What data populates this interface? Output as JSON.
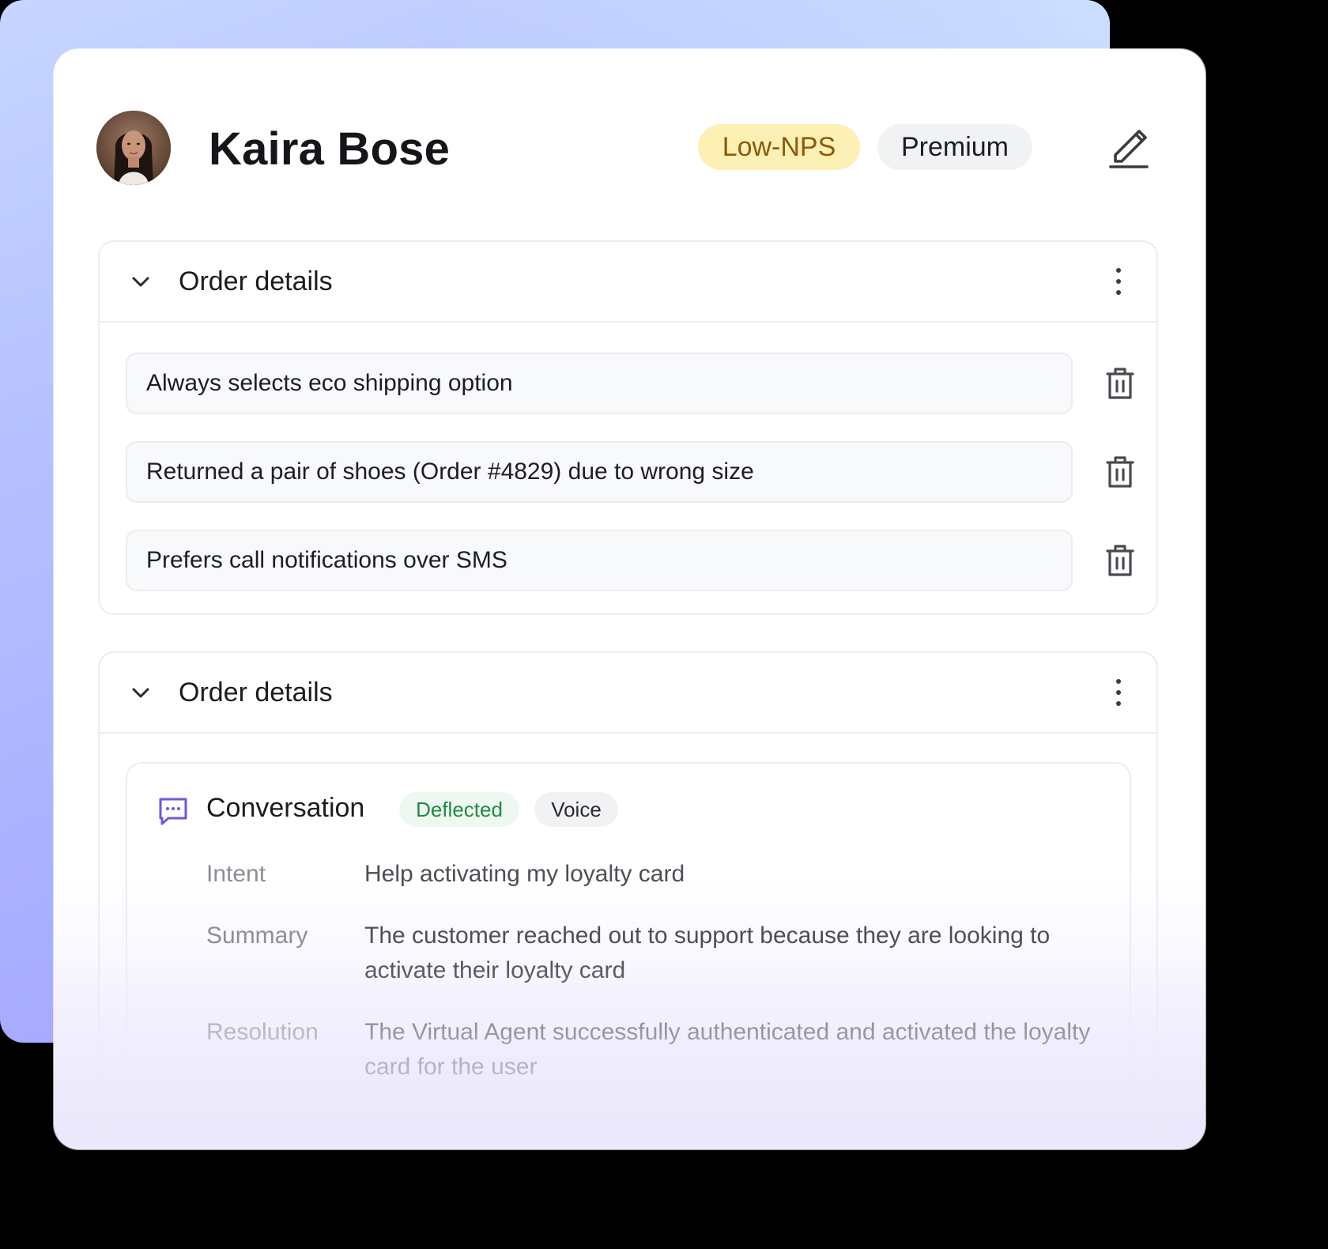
{
  "profile": {
    "name": "Kaira Bose",
    "badges": [
      "Low-NPS",
      "Premium"
    ]
  },
  "sections": [
    {
      "title": "Order details",
      "items": [
        "Always selects eco shipping option",
        "Returned a pair of shoes (Order #4829) due to wrong size",
        "Prefers call notifications over SMS"
      ]
    },
    {
      "title": "Order details",
      "conversation": {
        "title": "Conversation",
        "tags": [
          "Deflected",
          "Voice"
        ],
        "rows": [
          {
            "label": "Intent",
            "value": "Help activating my loyalty card"
          },
          {
            "label": "Summary",
            "value": "The customer reached out to support because they are looking to activate their loyalty card"
          },
          {
            "label": "Resolution",
            "value": "The Virtual Agent successfully authenticated and activated the loyalty card for the user"
          }
        ]
      }
    }
  ],
  "colors": {
    "low_nps_bg": "#fdf0b4",
    "low_nps_text": "#8a5a0a",
    "deflected_text": "#1f8a45",
    "conversation_icon": "#6a5ad8"
  }
}
